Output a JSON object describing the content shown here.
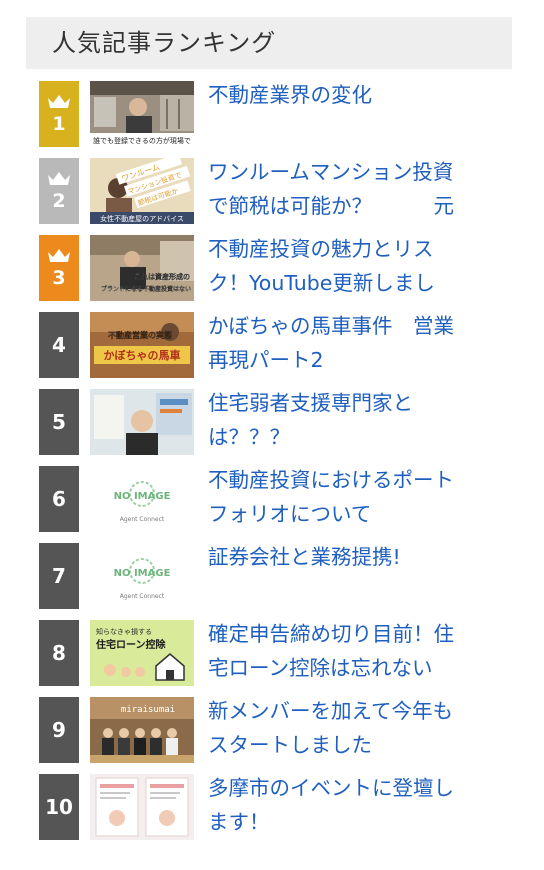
{
  "header": {
    "title": "人気記事ランキング"
  },
  "colors": {
    "gold": "#d8b21e",
    "silver": "#b9b9b9",
    "bronze": "#ec8a1d",
    "plain": "#555555",
    "link": "#1f5fbf"
  },
  "items": [
    {
      "rank": "1",
      "crown": true,
      "title": "不動産業界の変化"
    },
    {
      "rank": "2",
      "crown": true,
      "title": "ワンルームマンション投資\nで節税は可能か？　　　元"
    },
    {
      "rank": "3",
      "crown": true,
      "title": "不動産投資の魅力とリス\nク！YouTube更新しまし"
    },
    {
      "rank": "4",
      "crown": false,
      "title": "かぼちゃの馬車事件　営業\n再現パート2"
    },
    {
      "rank": "5",
      "crown": false,
      "title": "住宅弱者支援専門家と\nは？？？"
    },
    {
      "rank": "6",
      "crown": false,
      "title": "不動産投資におけるポート\nフォリオについて"
    },
    {
      "rank": "7",
      "crown": false,
      "title": "証券会社と業務提携!"
    },
    {
      "rank": "8",
      "crown": false,
      "title": "確定申告締め切り目前！住\n宅ローン控除は忘れない"
    },
    {
      "rank": "9",
      "crown": false,
      "title": "新メンバーを加えて今年も\nスタートしました"
    },
    {
      "rank": "10",
      "crown": false,
      "title": "多摩市のイベントに登壇し\nます！"
    }
  ],
  "thumbs": {
    "t1": "誰でも登録できるの方が現場で",
    "t2a": "ワンルーム",
    "t2b": "マンション投資で",
    "t2c": "節税は可能か",
    "t2d": "女性不動産屋のアドバイス",
    "t3a": "これは資産形成の",
    "t3b": "ブランドになる不動産投資はない",
    "t4a": "不動産営業の実態",
    "t4b": "かぼちゃの馬車",
    "noimage": "NO IMAGE",
    "agent": "Agent Connect",
    "t8a": "知らなきゃ損する",
    "t8b": "住宅ローン控除",
    "t9": "miraisumai"
  }
}
